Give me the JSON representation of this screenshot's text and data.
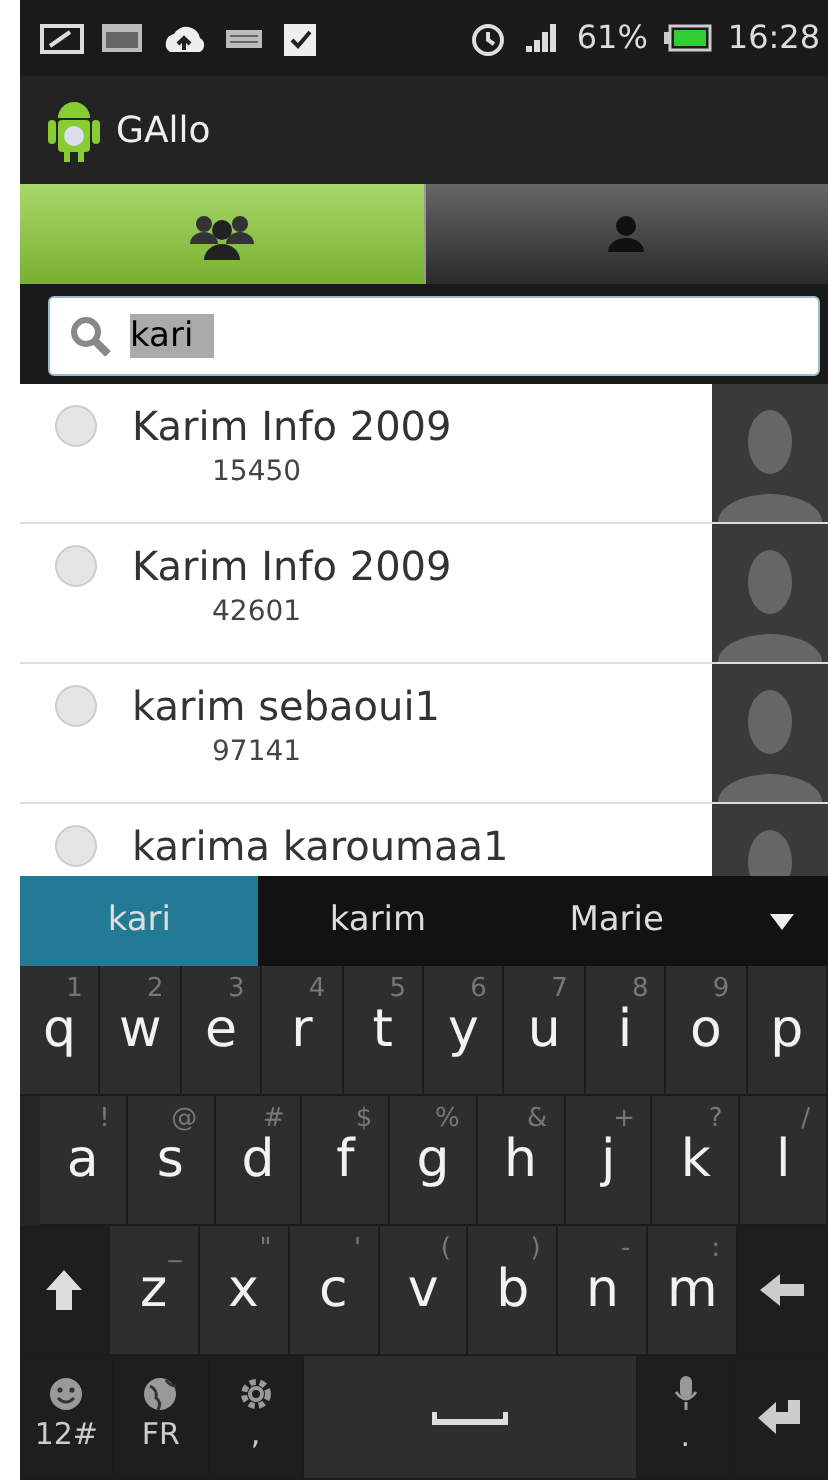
{
  "status_bar": {
    "battery": "61%",
    "time": "16:28"
  },
  "app_bar": {
    "title": "GAllo"
  },
  "tabs": [
    {
      "kind": "group",
      "selected": true
    },
    {
      "kind": "person",
      "selected": false
    }
  ],
  "search": {
    "value": "kari",
    "highlighted": true
  },
  "contacts": [
    {
      "name": "Karim Info 2009",
      "number": "15450",
      "checked": false
    },
    {
      "name": "Karim Info 2009",
      "number": "42601",
      "checked": false
    },
    {
      "name": "karim sebaoui1",
      "number": "97141",
      "checked": false
    },
    {
      "name": "karima karoumaa1",
      "checked": false
    }
  ],
  "suggestions": [
    {
      "text": "kari",
      "selected": true
    },
    {
      "text": "karim",
      "selected": false
    },
    {
      "text": "Marie",
      "selected": false
    }
  ],
  "keyboard": [
    [
      {
        "kind": "char",
        "label": "q",
        "hint": "1"
      },
      {
        "kind": "char",
        "label": "w",
        "hint": "2"
      },
      {
        "kind": "char",
        "label": "e",
        "hint": "3"
      },
      {
        "kind": "char",
        "label": "r",
        "hint": "4"
      },
      {
        "kind": "char",
        "label": "t",
        "hint": "5"
      },
      {
        "kind": "char",
        "label": "y",
        "hint": "6"
      },
      {
        "kind": "char",
        "label": "u",
        "hint": "7"
      },
      {
        "kind": "char",
        "label": "i",
        "hint": "8"
      },
      {
        "kind": "char",
        "label": "o",
        "hint": "9"
      },
      {
        "kind": "char",
        "label": "p"
      }
    ],
    [
      {
        "kind": "char",
        "label": "a",
        "hint": "!"
      },
      {
        "kind": "char",
        "label": "s",
        "hint": "@"
      },
      {
        "kind": "char",
        "label": "d",
        "hint": "#"
      },
      {
        "kind": "char",
        "label": "f",
        "hint": "$"
      },
      {
        "kind": "char",
        "label": "g",
        "hint": "%"
      },
      {
        "kind": "char",
        "label": "h",
        "hint": "&"
      },
      {
        "kind": "char",
        "label": "j",
        "hint": "+"
      },
      {
        "kind": "char",
        "label": "k",
        "hint": "?"
      },
      {
        "kind": "char",
        "label": "l",
        "hint": "/"
      }
    ],
    [
      {
        "kind": "shift"
      },
      {
        "kind": "char",
        "label": "z",
        "hint": "_"
      },
      {
        "kind": "char",
        "label": "x",
        "hint": "\""
      },
      {
        "kind": "char",
        "label": "c",
        "hint": "'"
      },
      {
        "kind": "char",
        "label": "v",
        "hint": "("
      },
      {
        "kind": "char",
        "label": "b",
        "hint": ")"
      },
      {
        "kind": "char",
        "label": "n",
        "hint": "-"
      },
      {
        "kind": "char",
        "label": "m",
        "hint": ":"
      },
      {
        "kind": "backspace"
      }
    ],
    [
      {
        "kind": "emoji",
        "label": "12#"
      },
      {
        "kind": "globe",
        "label": "FR"
      },
      {
        "kind": "gear",
        "label": ","
      },
      {
        "kind": "space"
      },
      {
        "kind": "mic",
        "label": "."
      },
      {
        "kind": "enter"
      }
    ]
  ]
}
